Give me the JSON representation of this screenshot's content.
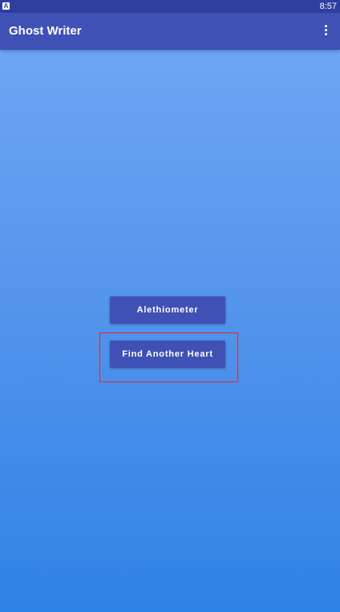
{
  "status_bar": {
    "app_icon_letter": "A",
    "time": "8:57"
  },
  "app_bar": {
    "title": "Ghost Writer",
    "overflow_icon": "more-vert-icon"
  },
  "main": {
    "buttons": [
      {
        "label": "Alethiometer"
      },
      {
        "label": "Find Another Heart"
      }
    ]
  },
  "colors": {
    "status_bar": "#2f3fa0",
    "app_bar": "#3f51b5",
    "button": "#3f51b5",
    "background_top": "#74a9f6",
    "background_bottom": "#2f82e6",
    "highlight": "#e0282b"
  }
}
